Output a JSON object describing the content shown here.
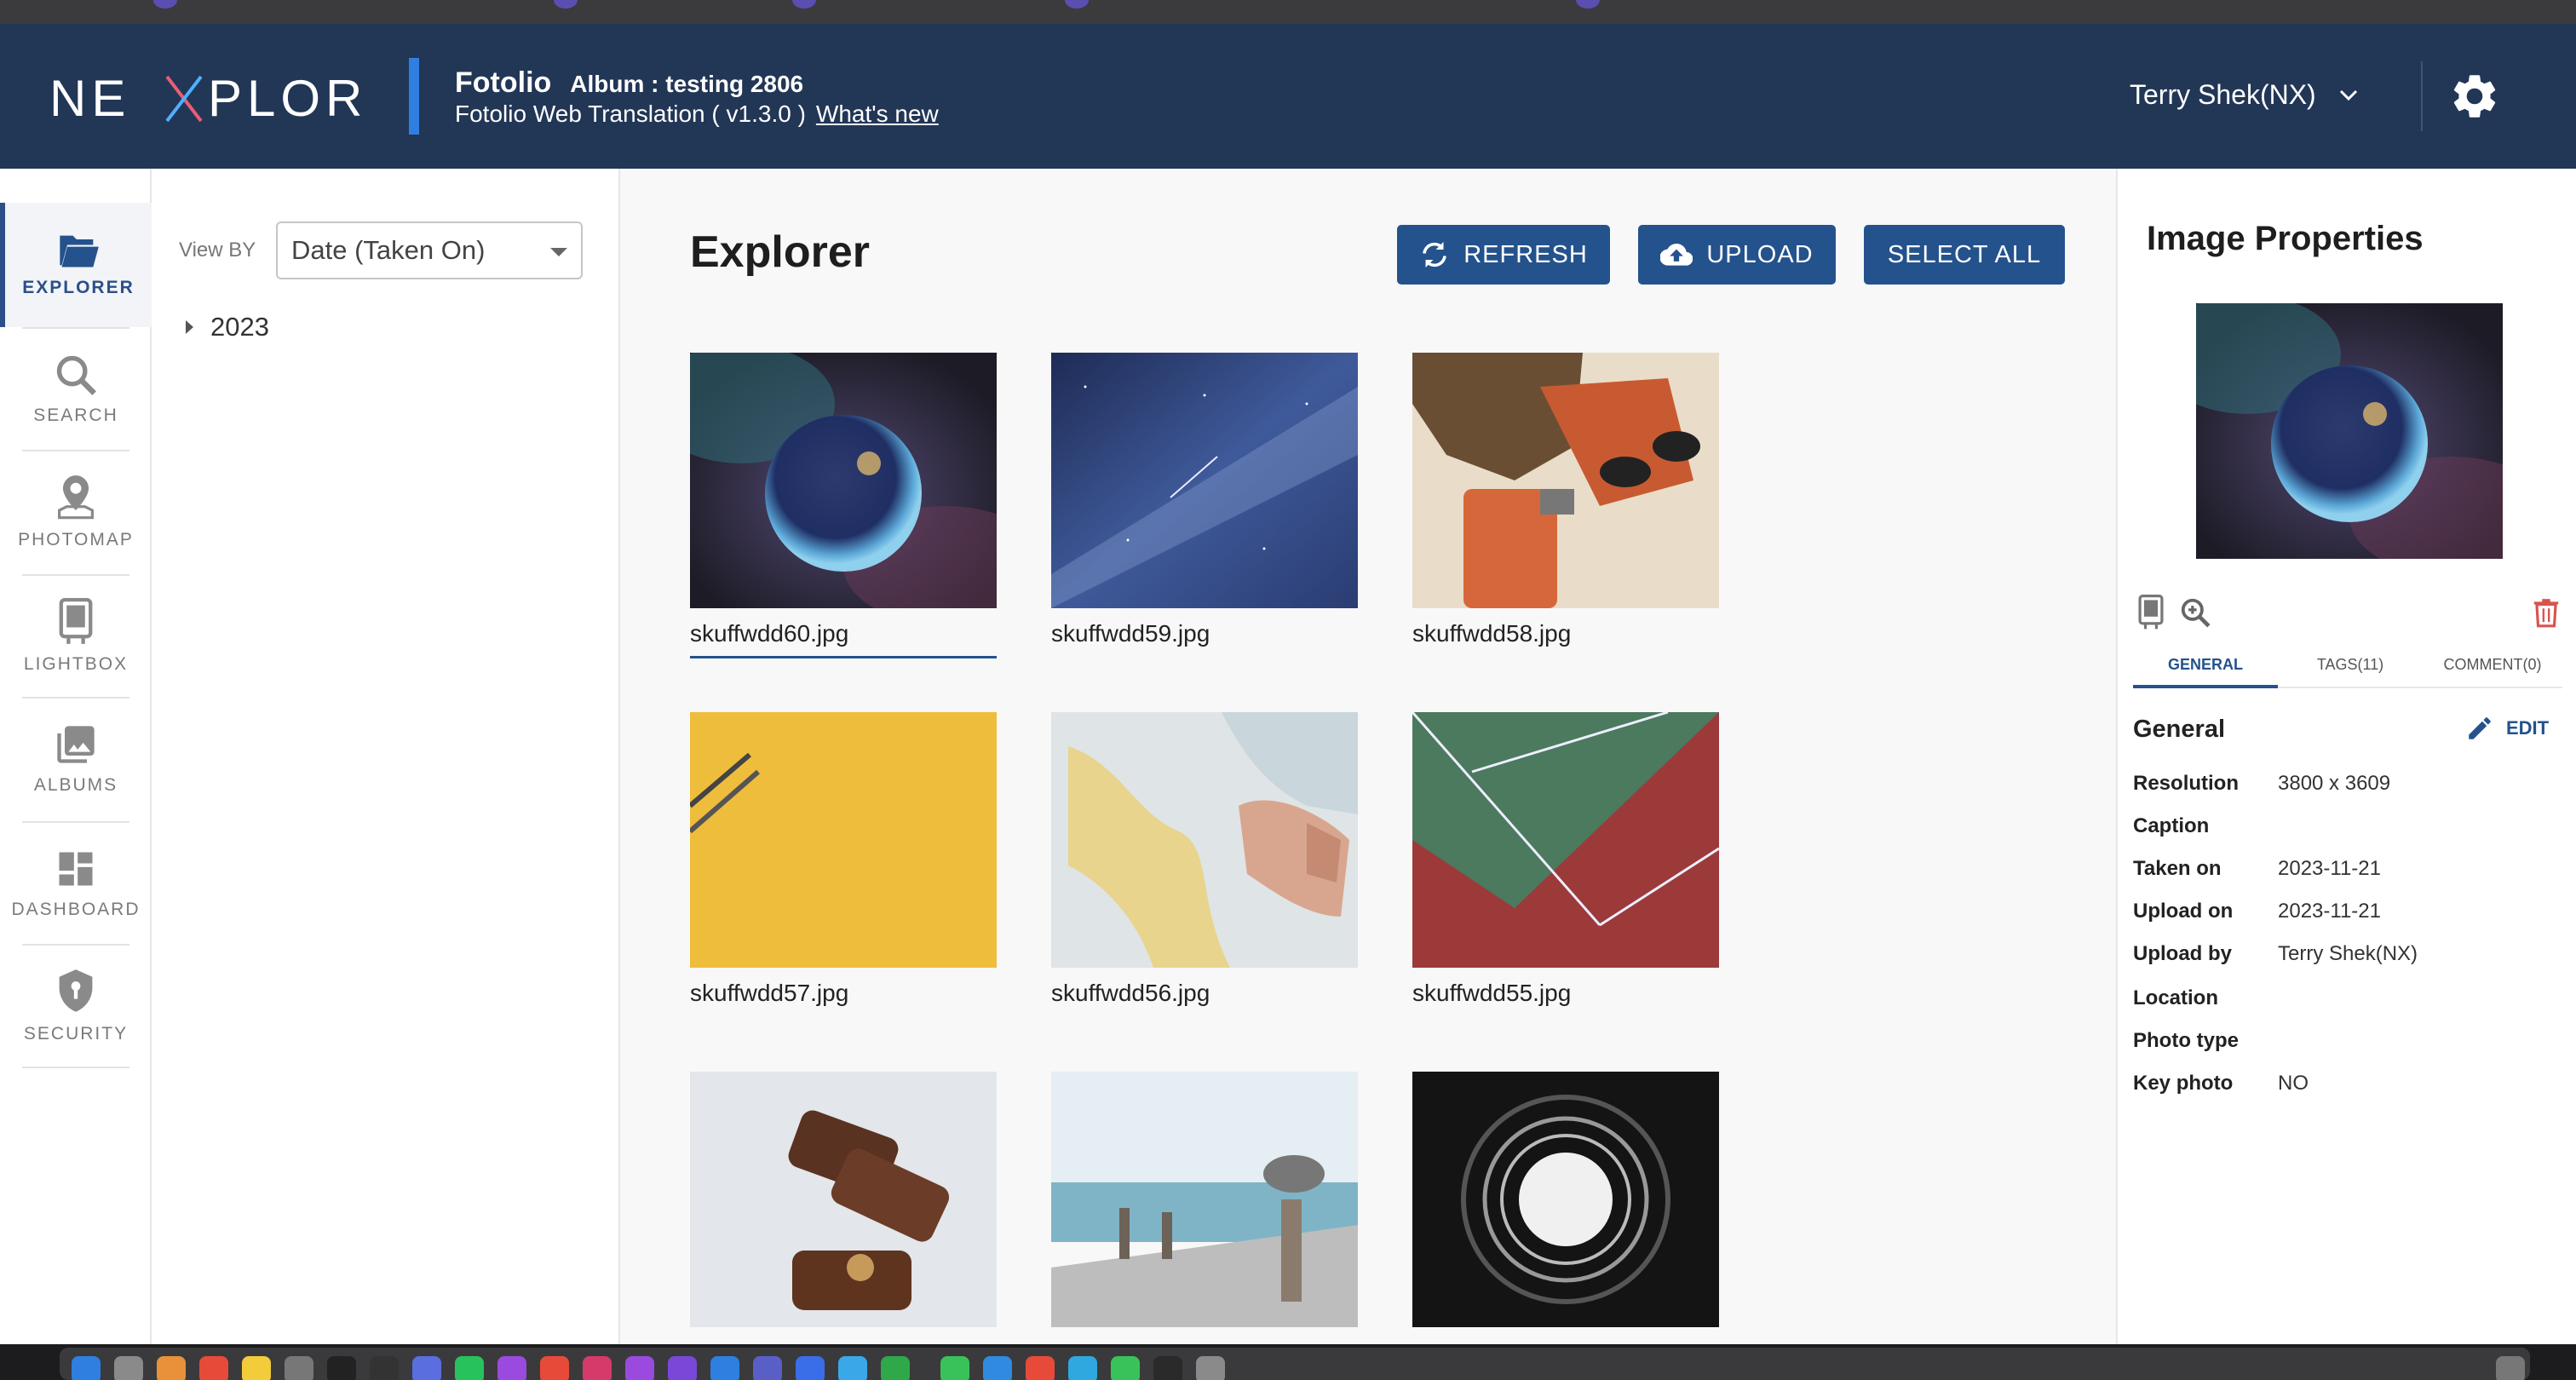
{
  "header": {
    "logo_text": "NEXPLORE",
    "app_name": "Fotolio",
    "album_label": "Album : testing 2806",
    "subtitle": "Fotolio Web Translation ( v1.3.0 )",
    "whats_new": "What's new",
    "user_name": "Terry Shek(NX)",
    "settings_icon": "gear-icon"
  },
  "sidenav": {
    "items": [
      {
        "label": "EXPLORER",
        "icon": "folder-open-icon",
        "active": true
      },
      {
        "label": "SEARCH",
        "icon": "search-icon"
      },
      {
        "label": "PHOTOMAP",
        "icon": "map-pin-icon"
      },
      {
        "label": "LIGHTBOX",
        "icon": "lightbox-icon"
      },
      {
        "label": "ALBUMS",
        "icon": "photo-albums-icon"
      },
      {
        "label": "DASHBOARD",
        "icon": "dashboard-icon"
      },
      {
        "label": "SECURITY",
        "icon": "shield-icon"
      }
    ]
  },
  "filter": {
    "view_by_label": "View BY",
    "view_by_value": "Date (Taken On)",
    "tree": [
      {
        "label": "2023"
      }
    ]
  },
  "explorer": {
    "title": "Explorer",
    "refresh_label": "REFRESH",
    "upload_label": "UPLOAD",
    "select_all_label": "SELECT ALL",
    "images": [
      {
        "name": "skuffwdd60.jpg",
        "selected": true
      },
      {
        "name": "skuffwdd59.jpg"
      },
      {
        "name": "skuffwdd58.jpg"
      },
      {
        "name": "skuffwdd57.jpg"
      },
      {
        "name": "skuffwdd56.jpg"
      },
      {
        "name": "skuffwdd55.jpg"
      },
      {
        "name": ""
      },
      {
        "name": ""
      },
      {
        "name": ""
      }
    ]
  },
  "properties": {
    "title": "Image Properties",
    "tabs": [
      "GENERAL",
      "TAGS(11)",
      "COMMENT(0)"
    ],
    "section_title": "General",
    "edit_label": "EDIT",
    "fields": [
      {
        "key": "Resolution",
        "value": "3800 x 3609"
      },
      {
        "key": "Caption",
        "value": ""
      },
      {
        "key": "Taken on",
        "value": "2023-11-21"
      },
      {
        "key": "Upload on",
        "value": "2023-11-21"
      },
      {
        "key": "Upload by",
        "value": "Terry Shek(NX)"
      },
      {
        "key": "Location",
        "value": ""
      },
      {
        "key": "Photo type",
        "value": ""
      },
      {
        "key": "Key photo",
        "value": "NO"
      }
    ]
  },
  "colors": {
    "header_bg": "#223656",
    "accent": "#24528c",
    "accent_bar": "#2f7fe0",
    "delete": "#d9534f"
  }
}
